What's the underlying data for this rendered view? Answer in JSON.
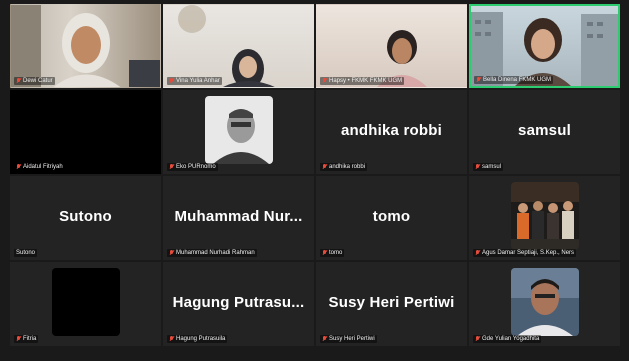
{
  "participants": [
    {
      "label": "Dewi Catur"
    },
    {
      "label": "Vina Yulia Anhar"
    },
    {
      "label": "Hapsy • FKMK FKMK UGM"
    },
    {
      "label": "Bella Dinena FKMK UGM"
    },
    {
      "label": "Aidatul Fitriyah"
    },
    {
      "label": "Eko PURnomo"
    },
    {
      "label": "andhika robbi",
      "display": "andhika robbi"
    },
    {
      "label": "samsul",
      "display": "samsul"
    },
    {
      "label": "Sutono",
      "display": "Sutono"
    },
    {
      "label": "Muhammad Nurhadi Rahman",
      "display": "Muhammad  Nur..."
    },
    {
      "label": "tomo",
      "display": "tomo"
    },
    {
      "label": "Agus Damar Septiaji, S.Kep., Ners"
    },
    {
      "label": "Fitria"
    },
    {
      "label": "Hagung Putrasuila",
      "display": "Hagung  Putrasu..."
    },
    {
      "label": "Susy Heri Pertiwi",
      "display": "Susy Heri Pertiwi"
    },
    {
      "label": "Gde Yulian Yogadhita"
    }
  ],
  "colors": {
    "background": "#1a1a1a",
    "tile": "#232323",
    "active_speaker_border": "#2ecc71",
    "muted_mic": "#e74c3c"
  },
  "icons": {
    "muted": "mic-muted-icon"
  }
}
